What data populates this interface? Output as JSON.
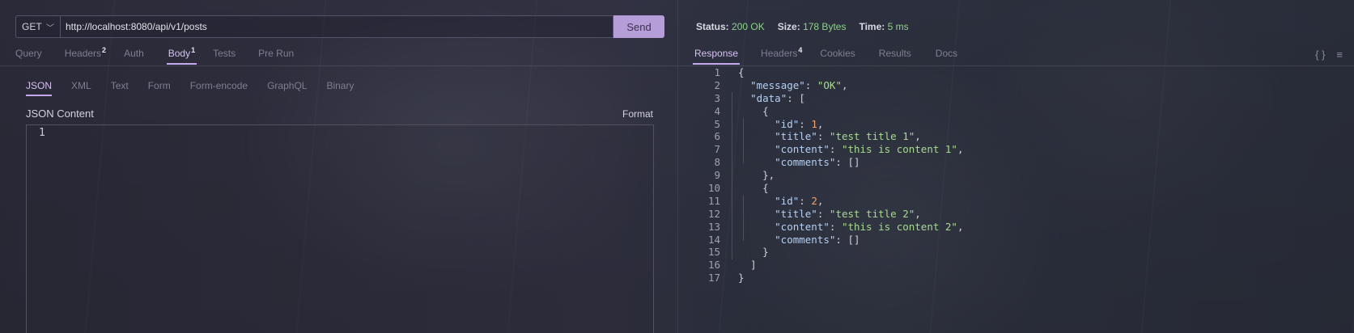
{
  "request": {
    "method": "GET",
    "url": "http://localhost:8080/api/v1/posts",
    "send_label": "Send"
  },
  "request_tabs": [
    {
      "label": "Query",
      "badge": ""
    },
    {
      "label": "Headers",
      "badge": "2"
    },
    {
      "label": "Auth",
      "badge": ""
    },
    {
      "label": "Body",
      "badge": "1",
      "active": true
    },
    {
      "label": "Tests",
      "badge": ""
    },
    {
      "label": "Pre Run",
      "badge": ""
    }
  ],
  "body_types": [
    "JSON",
    "XML",
    "Text",
    "Form",
    "Form-encode",
    "GraphQL",
    "Binary"
  ],
  "body_editor": {
    "label": "JSON Content",
    "format_label": "Format",
    "line_number": "1"
  },
  "response": {
    "status_label": "Status:",
    "status_value": "200 OK",
    "size_label": "Size:",
    "size_value": "178 Bytes",
    "time_label": "Time:",
    "time_value": "5 ms"
  },
  "response_tabs": [
    {
      "label": "Response",
      "badge": "",
      "active": true
    },
    {
      "label": "Headers",
      "badge": "4"
    },
    {
      "label": "Cookies",
      "badge": ""
    },
    {
      "label": "Results",
      "badge": ""
    },
    {
      "label": "Docs",
      "badge": ""
    }
  ],
  "response_icons": {
    "braces": "{ }",
    "menu": "≡"
  },
  "response_body": {
    "message": "OK",
    "posts": [
      {
        "id": "1",
        "title": "test title 1",
        "content": "this is content 1"
      },
      {
        "id": "2",
        "title": "test title 2",
        "content": "this is content 2"
      }
    ]
  },
  "colors": {
    "accent": "#b59ed8",
    "status_ok": "#8ed289"
  }
}
